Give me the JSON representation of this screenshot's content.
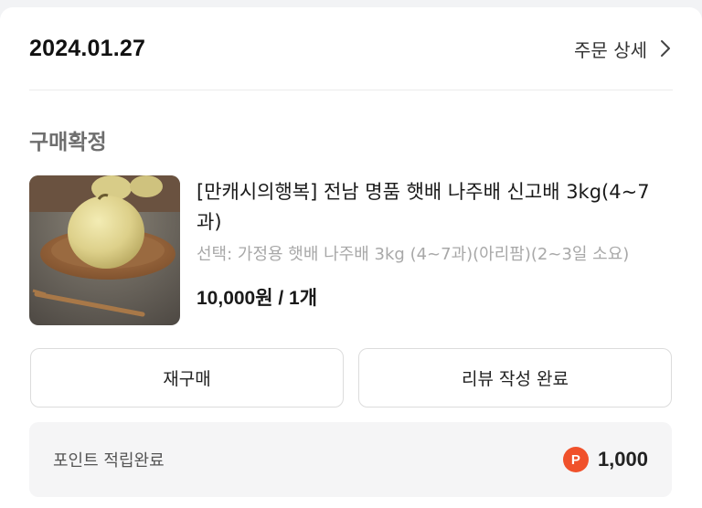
{
  "order": {
    "date": "2024.01.27",
    "detail_label": "주문 상세"
  },
  "status": "구매확정",
  "product": {
    "title": "[만캐시의행복] 전남 명품 햇배 나주배 신고배 3kg(4~7과)",
    "option": "선택: 가정용 햇배 나주배 3kg (4~7과)(아리팜)(2~3일 소요)",
    "price_qty": "10,000원 / 1개",
    "image_icon": "pear-on-plate-photo"
  },
  "buttons": {
    "rebuy": "재구매",
    "review": "리뷰 작성 완료"
  },
  "points": {
    "label": "포인트 적립완료",
    "badge": "P",
    "amount": "1,000",
    "badge_color": "#f0512b"
  }
}
